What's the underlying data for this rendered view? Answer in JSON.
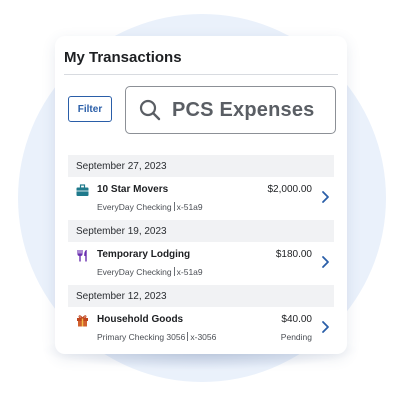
{
  "title": "My Transactions",
  "filter_label": "Filter",
  "search": {
    "value": "PCS Expenses"
  },
  "colors": {
    "accent": "#2a5ea8",
    "background_circle": "#eaf1fb",
    "header_bg": "#f1f2f4"
  },
  "groups": [
    {
      "date": "September 27, 2023",
      "transactions": [
        {
          "icon": "briefcase-icon",
          "icon_color": "#1f7a8c",
          "name": "10 Star Movers",
          "account": "EveryDay Checking",
          "account_number": "x-51a9",
          "amount": "$2,000.00",
          "status": ""
        }
      ]
    },
    {
      "date": "September 19, 2023",
      "transactions": [
        {
          "icon": "utensils-icon",
          "icon_color": "#6a2fb0",
          "name": "Temporary Lodging",
          "account": "EveryDay Checking",
          "account_number": "x-51a9",
          "amount": "$180.00",
          "status": ""
        }
      ]
    },
    {
      "date": "September 12, 2023",
      "transactions": [
        {
          "icon": "gift-icon",
          "icon_color": "#c0451e",
          "name": "Household Goods",
          "account": "Primary Checking 3056",
          "account_number": "x-3056",
          "amount": "$40.00",
          "status": "Pending"
        }
      ]
    }
  ]
}
